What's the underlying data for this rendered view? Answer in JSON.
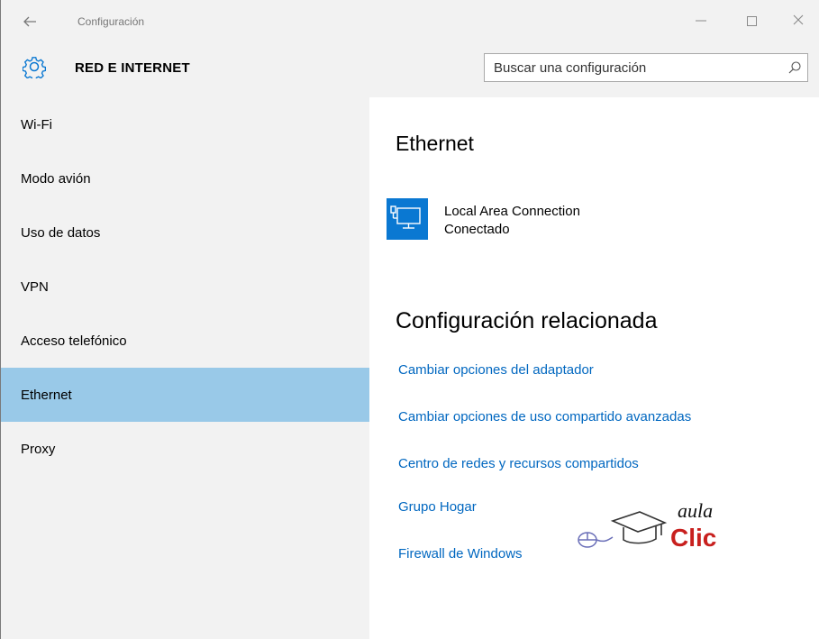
{
  "titlebar": {
    "app_title": "Configuración",
    "back_icon": "back-arrow-icon",
    "minimize_icon": "minimize-icon",
    "maximize_icon": "maximize-icon",
    "close_icon": "close-icon"
  },
  "header": {
    "title": "RED E INTERNET",
    "search_placeholder": "Buscar una configuración",
    "search_value": ""
  },
  "sidebar": {
    "items": [
      {
        "label": "Wi-Fi",
        "selected": false
      },
      {
        "label": "Modo avión",
        "selected": false
      },
      {
        "label": "Uso de datos",
        "selected": false
      },
      {
        "label": "VPN",
        "selected": false
      },
      {
        "label": "Acceso telefónico",
        "selected": false
      },
      {
        "label": "Ethernet",
        "selected": true
      },
      {
        "label": "Proxy",
        "selected": false
      }
    ]
  },
  "main": {
    "heading": "Ethernet",
    "connection": {
      "name": "Local Area Connection",
      "status": "Conectado",
      "icon": "ethernet-monitor-icon"
    },
    "related_heading": "Configuración relacionada",
    "links": [
      "Cambiar opciones del adaptador",
      "Cambiar opciones de uso compartido avanzadas",
      "Centro de redes y recursos compartidos",
      "Grupo Hogar",
      "Firewall de Windows"
    ]
  },
  "watermark": {
    "text_top": "aula",
    "text_bottom": "Clic"
  },
  "colors": {
    "accent": "#0a78d2",
    "selected_bg": "#99c9e8",
    "link": "#0067c0",
    "sidebar_bg": "#f2f2f2",
    "logo_red": "#c8201e"
  }
}
